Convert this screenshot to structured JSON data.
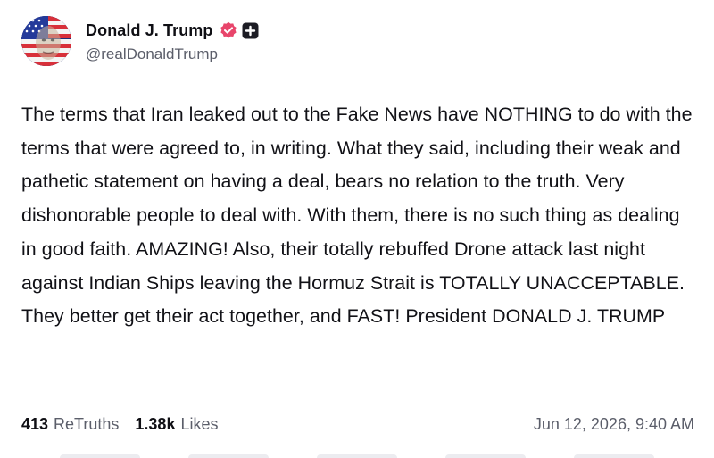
{
  "author": {
    "display_name": "Donald J. Trump",
    "handle": "@realDonaldTrump",
    "verified_icon": "verified-badge-icon",
    "plus_icon": "plus-square-icon"
  },
  "post": {
    "text": "The terms that Iran leaked out to the Fake News have NOTHING to do with the terms that were agreed to, in writing. What they said, including their weak and pathetic statement on having a deal, bears no relation to the truth. Very dishonorable people to deal with. With them, there is no such thing as dealing in good faith. AMAZING! Also, their totally rebuffed Drone attack last night against Indian Ships leaving the Hormuz Strait is TOTALLY UNACCEPTABLE. They better get their act together, and FAST! President DONALD J. TRUMP"
  },
  "stats": {
    "retruths_count": "413",
    "retruths_label": "ReTruths",
    "likes_count": "1.38k",
    "likes_label": "Likes"
  },
  "timestamp": "Jun 12, 2026, 9:40 AM",
  "colors": {
    "verified_badge": "#e8456b",
    "text_primary": "#0f0f14",
    "text_secondary": "#5b5e6a"
  }
}
